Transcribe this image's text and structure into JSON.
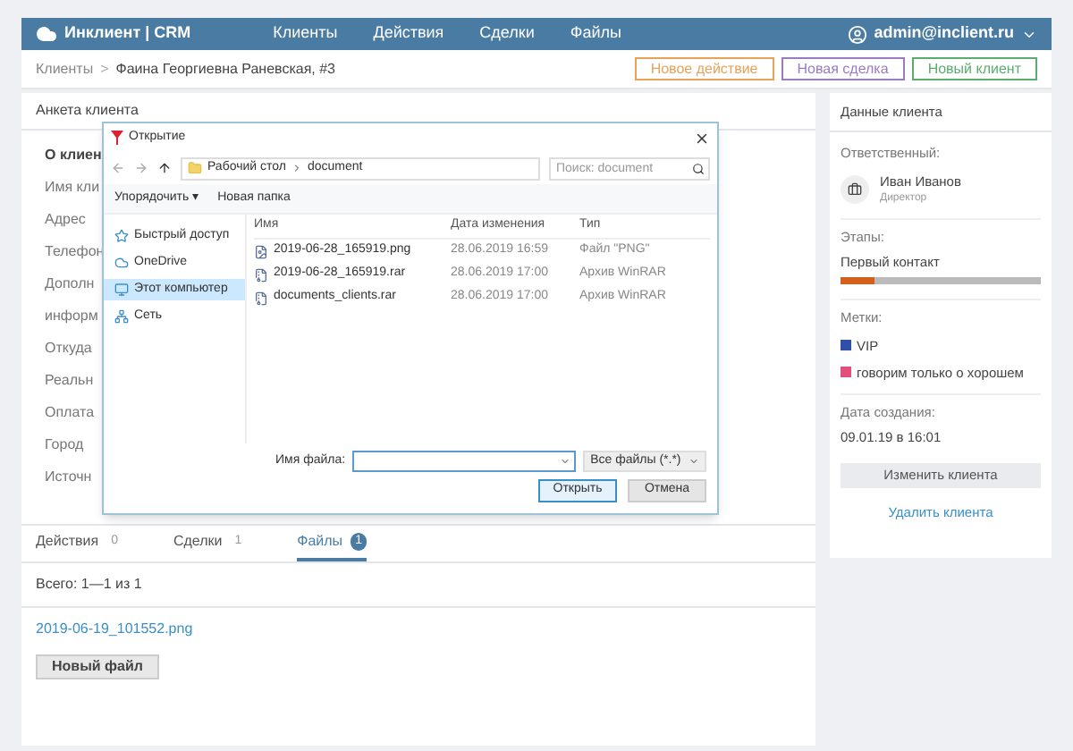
{
  "header": {
    "brand": "Инклиент | CRM",
    "nav": [
      {
        "label": "Клиенты"
      },
      {
        "label": "Действия"
      },
      {
        "label": "Сделки"
      },
      {
        "label": "Файлы"
      }
    ],
    "user": "admin@inclient.ru"
  },
  "breadcrumb": {
    "parent": "Клиенты",
    "separator": ">",
    "current": "Фаина Георгиевна Раневская, #3"
  },
  "actions": [
    {
      "label": "Новое действие",
      "color": "#e8a25a"
    },
    {
      "label": "Новая сделка",
      "color": "#9a7cc4"
    },
    {
      "label": "Новый клиент",
      "color": "#5aad6e"
    }
  ],
  "card": {
    "title": "Анкета клиента",
    "section": "О клиен",
    "labels": [
      "Имя кли",
      "Адрес",
      "Телефон",
      "Дополн",
      "информ",
      "Откуда",
      "Реальн",
      "Оплата",
      "Город",
      "Источн"
    ]
  },
  "tabs": [
    {
      "label": "Действия",
      "count": "0",
      "selected": false
    },
    {
      "label": "Сделки",
      "count": "1",
      "selected": false
    },
    {
      "label": "Файлы",
      "count": "1",
      "selected": true
    }
  ],
  "files_list": {
    "total": "Всего: 1—1 из 1",
    "file": "2019-06-19_101552.png",
    "button": "Новый файл"
  },
  "sidebar": {
    "title": "Данные клиента",
    "responsible_label": "Ответственный:",
    "person": "Иван Иванов",
    "role": "Директор",
    "stages_label": "Этапы:",
    "stage": "Первый контакт",
    "level": 0.17,
    "tags_label": "Метки:",
    "tags": [
      {
        "label": "VIP",
        "color": "#2f4fa8"
      },
      {
        "label": "говорим только о хорошем",
        "color": "#e0507a"
      }
    ],
    "created_label": "Дата создания:",
    "created": "09.01.19 в 16:01",
    "edit_button": "Изменить клиента",
    "delete_link": "Удалить клиента"
  },
  "dialog": {
    "title": "Открытие",
    "path": [
      "Рабочий стол",
      "document"
    ],
    "search": {
      "placeholder": "Поиск: document"
    },
    "organize": "Упорядочить ▾",
    "new_folder": "Новая папка",
    "nav": [
      {
        "label": "Быстрый доступ",
        "kind": "star",
        "selected": false
      },
      {
        "label": "OneDrive",
        "kind": "cloud",
        "selected": false
      },
      {
        "label": "Этот компьютер",
        "kind": "monitor",
        "selected": true
      },
      {
        "label": "Сеть",
        "kind": "network",
        "selected": false
      }
    ],
    "columns": [
      "Имя",
      "Дата изменения",
      "Тип"
    ],
    "files": [
      {
        "name": "2019-06-28_165919.png",
        "date": "28.06.2019 16:59",
        "type": "Файл \"PNG\"",
        "kind": "image"
      },
      {
        "name": "2019-06-28_165919.rar",
        "date": "28.06.2019 17:00",
        "type": "Архив WinRAR",
        "kind": "archive"
      },
      {
        "name": "documents_clients.rar",
        "date": "28.06.2019 17:00",
        "type": "Архив WinRAR",
        "kind": "archive"
      }
    ],
    "filename_label": "Имя файла:",
    "filter": "Все файлы (*.*)",
    "open": "Открыть",
    "cancel": "Отмена"
  }
}
